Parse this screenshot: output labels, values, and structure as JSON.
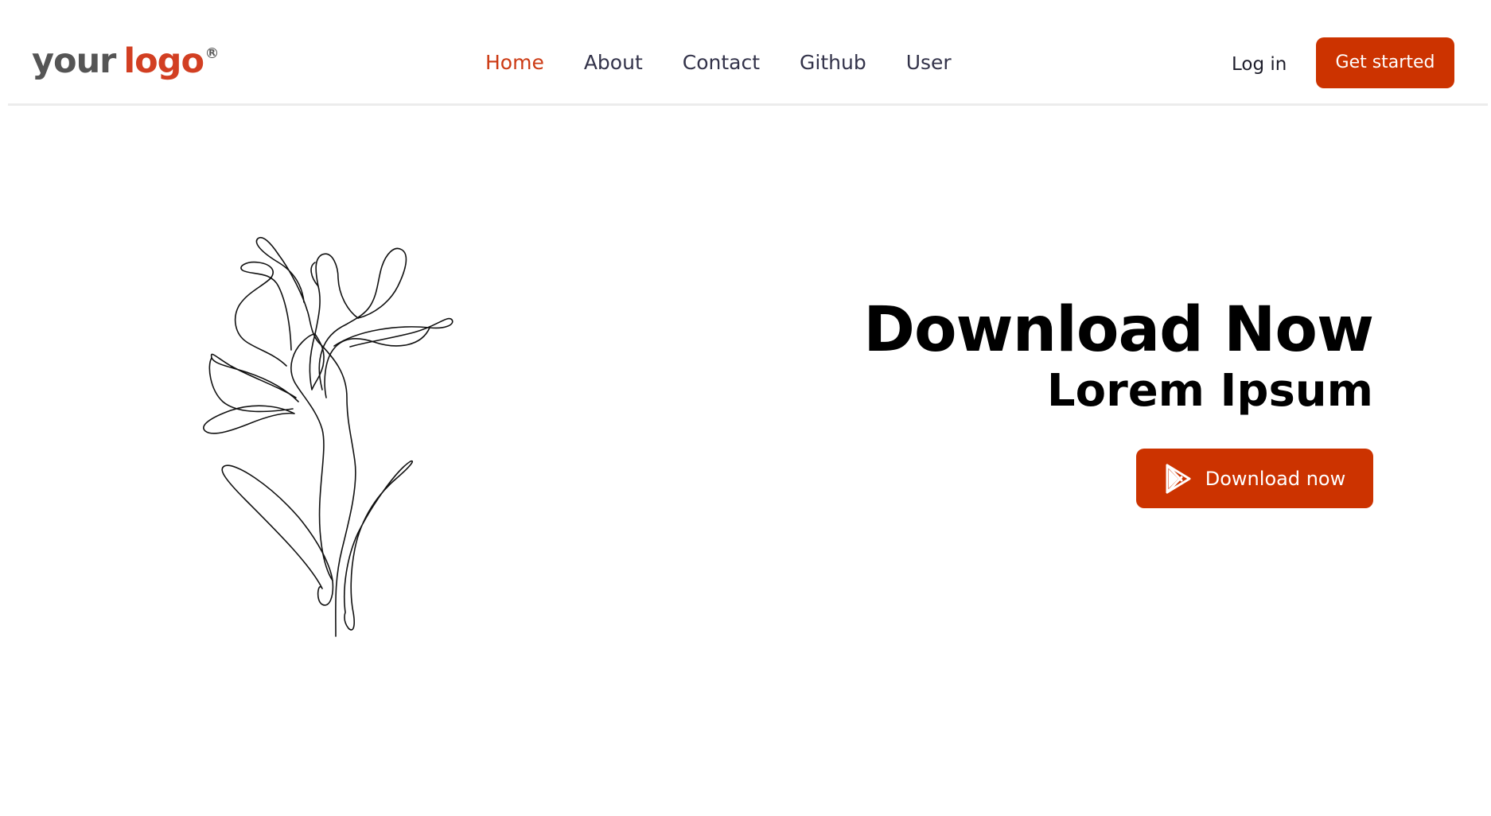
{
  "header": {
    "logo": {
      "part1": "your",
      "part2": "logo",
      "trademark": "R"
    },
    "nav": [
      {
        "label": "Home",
        "active": true
      },
      {
        "label": "About",
        "active": false
      },
      {
        "label": "Contact",
        "active": false
      },
      {
        "label": "Github",
        "active": false
      },
      {
        "label": "User",
        "active": false
      }
    ],
    "login_label": "Log in",
    "cta_label": "Get started"
  },
  "hero": {
    "title": "Download Now",
    "subtitle": "Lorem Ipsum",
    "download_label": "Download now",
    "download_icon": "play-store-icon",
    "illustration": "line-art-flower-illustration"
  },
  "colors": {
    "accent": "#cc3300",
    "nav_active": "#cc3a13",
    "nav_text": "#33334a",
    "logo_gray": "#555555",
    "logo_red": "#d23f22"
  }
}
